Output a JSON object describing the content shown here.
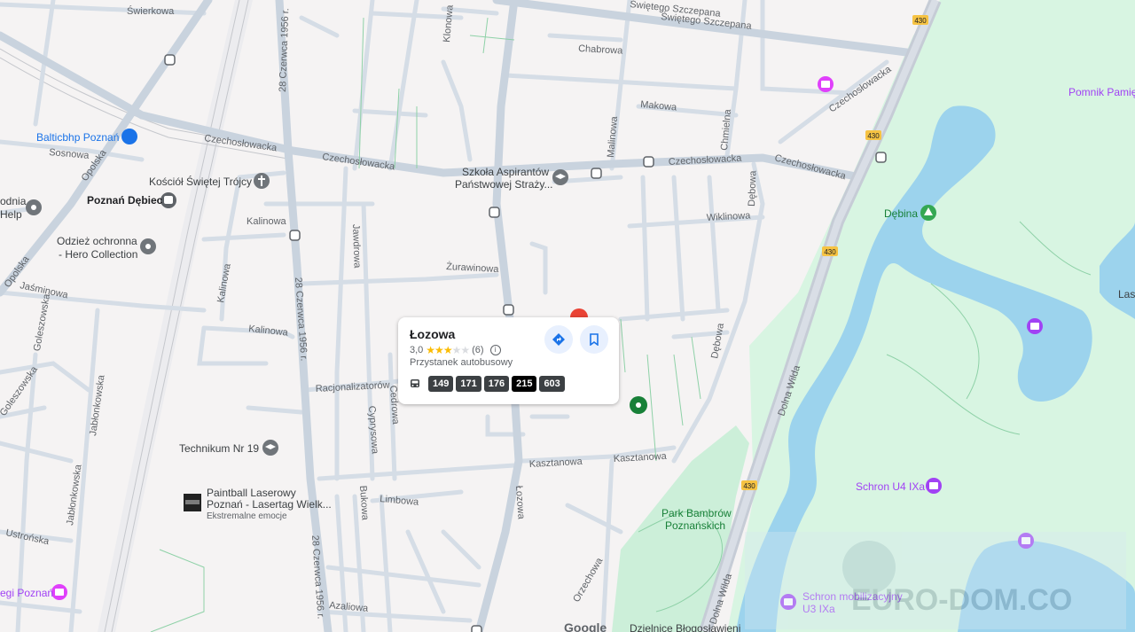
{
  "card": {
    "title": "Łozowa",
    "rating_value": "3,0",
    "rating_stars": 3,
    "rating_count": "(6)",
    "type": "Przystanek autobusowy",
    "routes": [
      "149",
      "171",
      "176",
      "215",
      "603"
    ],
    "active_route": "215",
    "directions_icon": "directions-icon",
    "save_icon": "bookmark-icon"
  },
  "streets": {
    "swierkowa": "Świerkowa",
    "swietego_szczepana_1": "Świętego Szczepana",
    "swietego_szczepana_2": "Świętego Szczepana",
    "chabrowa": "Chabrowa",
    "makowa": "Makowa",
    "klonowa": "Klonowa",
    "malinowa": "Malinowa",
    "chmielna": "Chmielna",
    "czechoslowacka_1": "Czechosłowacka",
    "czechoslowacka_2": "Czechosłowacka",
    "czechoslowacka_3": "Czechosłowacka",
    "czechoslowacka_4": "Czechosłowacka",
    "czechoslowacka_5": "Czechosłowacka",
    "sosnowa": "Sosnowa",
    "opolska_1": "Opolska",
    "opolska_2": "Opolska",
    "jasminowa": "Jaśminowa",
    "kalinowa_1": "Kalinowa",
    "kalinowa_2": "Kalinowa",
    "kalinowa_3": "Kalinowa",
    "jawdrowa": "Jawdrowa",
    "zurawinowa": "Żurawinowa",
    "wiklinowa": "Wiklinowa",
    "debowa_1": "Dębowa",
    "debowa_2": "Dębowa",
    "czerwca_1": "28 Czerwca 1956 r.",
    "czerwca_2": "28 Czerwca 1956 r.",
    "czerwca_3": "28 Czerwca 1956 r.",
    "racjonalizatorow": "Racjonalizatorów",
    "cyprysowa": "Cyprysowa",
    "cedrowa": "Cedrowa",
    "goleszowska": "Goleszowska",
    "goleszowska_2": "Goleszowska",
    "jablonkowska_1": "Jabłonkowska",
    "jablonkowska_2": "Jabłonkowska",
    "kasztanowa_1": "Kasztanowa",
    "kasztanowa_2": "Kasztanowa",
    "lozowa": "Łozowa",
    "limbowa": "Limbowa",
    "bukowa": "Bukowa",
    "orzechowa": "Orzechowa",
    "azaliowa": "Azaliowa",
    "ustronska": "Ustrońska",
    "dolna_wilda_1": "Dolna Wilda",
    "dolna_wilda_2": "Dolna Wilda",
    "road_430": "430"
  },
  "pois": {
    "balticbhp": "Balticbhp Poznań",
    "poznan_debiec": "Poznań Dębiec",
    "kosciol": "Kościół Świętej Trójcy",
    "odziez_1": "Odzież ochronna",
    "odziez_2": "- Hero Collection",
    "help_1": "odnia",
    "help_2": "Help",
    "szkola_1": "Szkoła Aspirantów",
    "szkola_2": "Państwowej Straży...",
    "technikum": "Technikum Nr 19",
    "paintball_1": "Paintball Laserowy",
    "paintball_2": "Poznań - Lasertag Wielk...",
    "paintball_3": "Ekstremalne emocje",
    "debina": "Dębina",
    "pomnik": "Pomnik Pamię",
    "schron_u4": "Schron U4 IXa",
    "schron_mob_1": "Schron mobilizacyjny",
    "schron_mob_2": "U3 IXa",
    "park_1": "Park Bambrów",
    "park_2": "Poznańskich",
    "egi": "egi Poznań",
    "las": "Las",
    "google": "Google",
    "bottom_partial": "Dzielnice Błogosławieni"
  },
  "watermark": "EURO-DOM.CO",
  "colors": {
    "water": "#9cd3ed",
    "park": "#d8f5e2",
    "road": "#d5dde6",
    "main_road": "#c9d3de",
    "background": "#f5f3f3",
    "accent_blue": "#1a73e8",
    "marker_red": "#ea4335"
  }
}
